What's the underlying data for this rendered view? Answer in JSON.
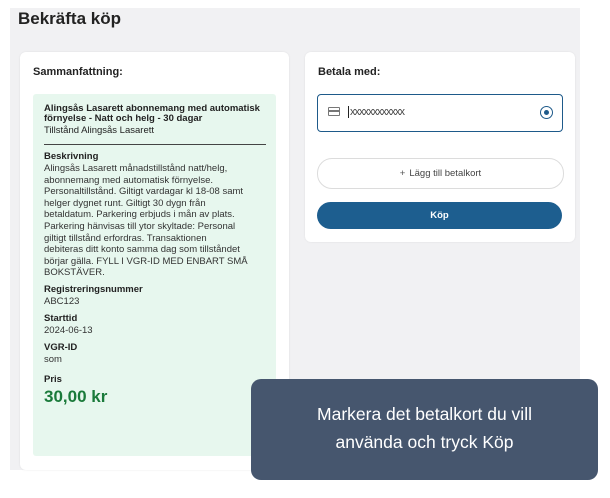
{
  "page": {
    "title": "Bekräfta köp"
  },
  "summary": {
    "heading": "Sammanfattning:",
    "product_name_line1": "Alingsås Lasarett abonnemang med automatisk",
    "product_name_line2": "förnyelse - Natt och helg - 30 dagar",
    "product_subtitle": "Tillstånd Alingsås Lasarett",
    "description_label": "Beskrivning",
    "description_lines": [
      "Alingsås Lasarett månadstillstånd natt/helg,",
      "abonnemang med automatisk förnyelse.",
      "Personaltillstånd. Giltigt vardagar kl 18-08 samt",
      "helger dygnet runt. Giltigt 30 dygn från",
      "betaldatum. Parkering erbjuds i mån av plats.",
      "Parkering hänvisas till ytor skyltade: Personal",
      "giltigt tillstånd erfordras. Transaktionen",
      "debiteras ditt konto samma dag som tillståndet",
      "börjar gälla. FYLL I VGR-ID MED ENBART SMÅ",
      "BOKSTÄVER."
    ],
    "registration_label": "Registreringsnummer",
    "registration_value": "ABC123",
    "start_label": "Starttid",
    "start_value": "2024-06-13",
    "vgr_label": "VGR-ID",
    "vgr_value": "som",
    "price_label": "Pris",
    "price_value": "30,00 kr"
  },
  "payment": {
    "heading": "Betala med:",
    "selected_card": "xxxxxxxxxxxx",
    "add_card_label": "Lägg till betalkort",
    "buy_label": "Köp"
  },
  "tooltip": {
    "line1": "Markera det betalkort du vill",
    "line2": "använda och tryck Köp"
  },
  "colors": {
    "primary": "#1d5e8f",
    "summary_bg": "#e7f7ee",
    "price": "#1a7a3a",
    "tooltip_bg": "#46566e"
  }
}
